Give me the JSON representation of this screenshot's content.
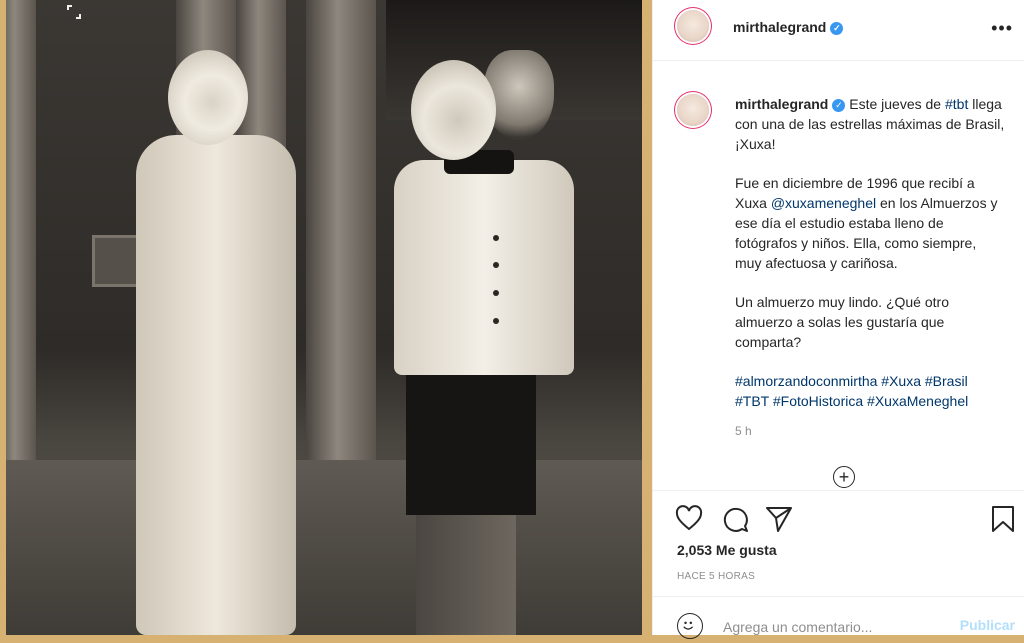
{
  "post": {
    "username": "mirthalegrand",
    "caption_intro": "Este jueves de ",
    "caption_tag_tbt": "#tbt",
    "caption_intro_rest": " llega con una de las estrellas máximas de Brasil, ¡Xuxa!",
    "caption_p2_a": "Fue en diciembre de 1996 que recibí a Xuxa ",
    "caption_p2_mention": "@xuxameneghel",
    "caption_p2_b": " en los Almuerzos y ese día el estudio estaba lleno de fotógrafos y niños. Ella, como siempre, muy afectuosa y cariñosa.",
    "caption_p3": "Un almuerzo muy lindo. ¿Qué otro almuerzo a solas les gustaría que comparta?",
    "hashtags": [
      "#almorzandoconmirtha",
      "#Xuxa",
      "#Brasil",
      "#TBT",
      "#FotoHistorica",
      "#XuxaMeneghel"
    ],
    "time_ago": "5 h",
    "likes": "2,053 Me gusta",
    "posted": "HACE 5 HORAS"
  },
  "comment": {
    "placeholder": "Agrega un comentario...",
    "publish_label": "Publicar"
  },
  "icons": {
    "verified": "verified-badge-icon",
    "more": "more-options-icon",
    "like": "heart-icon",
    "comment": "comment-icon",
    "share": "paper-plane-icon",
    "save": "bookmark-icon",
    "emoji": "emoji-icon",
    "load_more": "plus-circle-icon",
    "expand": "expand-icon"
  },
  "colors": {
    "frame": "#d7b172",
    "link": "#00376b",
    "verified": "#3897f0",
    "publish": "#b2dffc"
  }
}
